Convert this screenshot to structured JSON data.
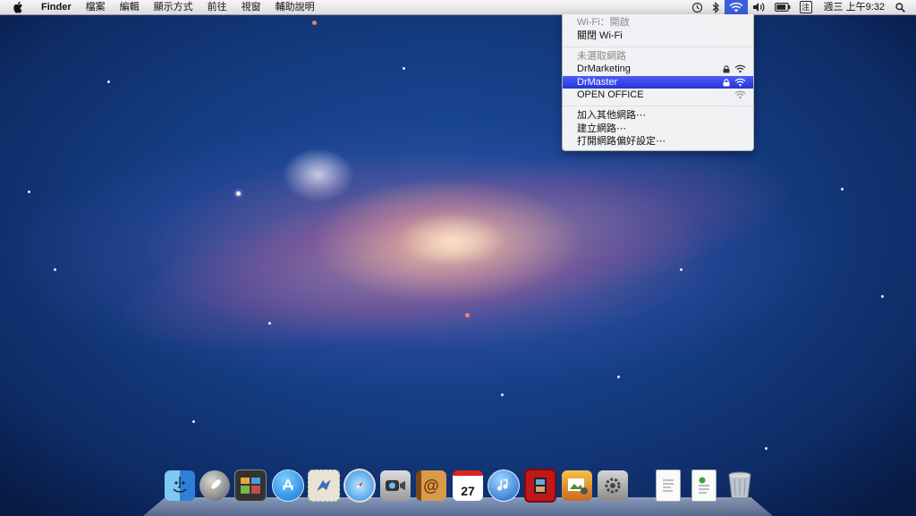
{
  "menubar": {
    "apple_icon": "apple-icon",
    "app_name": "Finder",
    "menus": [
      "檔案",
      "編輯",
      "顯示方式",
      "前往",
      "視窗",
      "輔助說明"
    ],
    "status_icons": [
      "time-machine-icon",
      "bluetooth-icon",
      "wifi-icon",
      "volume-icon",
      "battery-icon",
      "input-method-icon",
      "spotlight-icon"
    ],
    "input_method_label": "注",
    "clock": "週三 上午9:32"
  },
  "wifi_menu": {
    "status": "Wi-Fi：開啟",
    "toggle": "關閉 Wi-Fi",
    "networks_header": "未選取網路",
    "networks": [
      {
        "name": "DrMarketing",
        "locked": true
      },
      {
        "name": "DrMaster",
        "locked": true,
        "selected": true
      },
      {
        "name": "OPEN OFFICE",
        "locked": false
      }
    ],
    "join_other": "加入其他網路⋯",
    "create_network": "建立網路⋯",
    "open_preferences": "打開網路偏好設定⋯",
    "highlight_color": "#2f3fe0"
  },
  "dock": {
    "items": [
      "finder-icon",
      "launchpad-icon",
      "mission-control-icon",
      "app-store-icon",
      "mail-icon",
      "safari-icon",
      "facetime-icon",
      "address-book-icon",
      "calendar-icon",
      "itunes-icon",
      "photo-booth-icon",
      "iphoto-icon",
      "system-preferences-icon",
      "document-icon",
      "downloads-icon",
      "trash-icon"
    ],
    "calendar_day": "27"
  }
}
